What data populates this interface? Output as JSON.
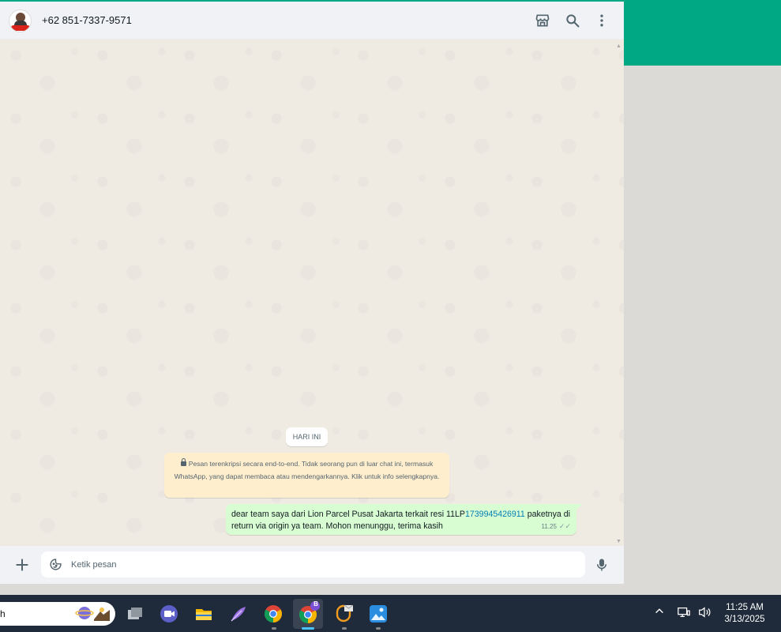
{
  "window": {
    "accent_color": "#00a884"
  },
  "chat_header": {
    "contact_name": "+62 851-7337-9571",
    "avatar_name": "contact-avatar",
    "icons": [
      "store-icon",
      "search-icon",
      "more-vertical-icon"
    ]
  },
  "messages": {
    "day_divider": "HARI INI",
    "encryption_notice": "Pesan terenkripsi secara end-to-end. Tidak seorang pun di luar chat ini, termasuk WhatsApp, yang dapat membaca atau mendengarkannya. Klik untuk info selengkapnya.",
    "outgoing": {
      "text_before": "dear team saya dari Lion Parcel Pusat Jakarta terkait resi 11LP",
      "link_text": "1739945426911",
      "text_after": " paketnya di return via origin ya team. Mohon menunggu, terima kasih",
      "time": "11.25",
      "status": "delivered"
    }
  },
  "composer": {
    "placeholder": "Ketik pesan",
    "icons": [
      "plus-icon",
      "sticker-icon",
      "microphone-icon"
    ]
  },
  "taskbar": {
    "search_text": "h",
    "apps": [
      "task-view-icon",
      "video-meet-icon",
      "file-explorer-icon",
      "quill-icon",
      "chrome-icon",
      "chrome-profile-icon",
      "mail-app-icon",
      "photos-icon"
    ],
    "active_app_badge": "B",
    "clock_time": "11:25 AM",
    "clock_date": "3/13/2025"
  }
}
